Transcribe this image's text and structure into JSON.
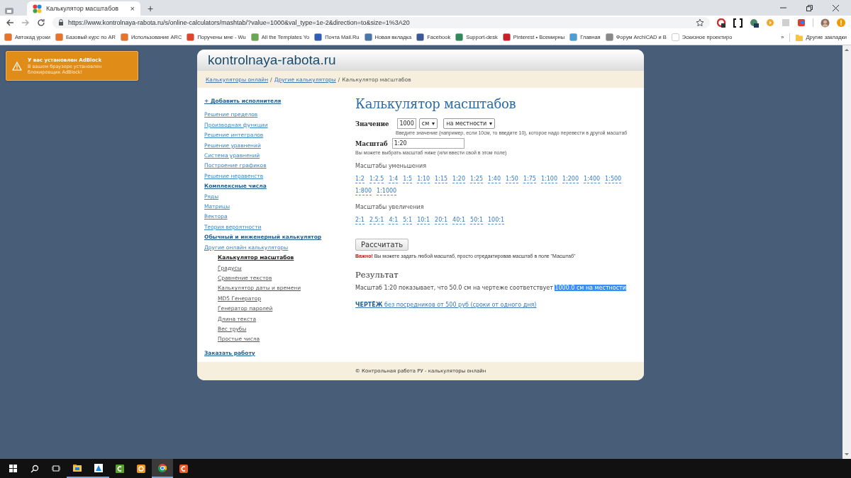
{
  "browser": {
    "tab": {
      "title": "Калькулятор масштабов",
      "close": "×"
    },
    "new_tab": "+",
    "url": "https://www.kontrolnaya-rabota.ru/s/online-calculators/mashtab/?value=1000&val_type=1e-2&direction=to&size=1%3A20",
    "bookmarks": [
      {
        "label": "Автокад уроки",
        "color": "#e8742a"
      },
      {
        "label": "Базовый курс по AR",
        "color": "#e8742a"
      },
      {
        "label": "Использование ARC",
        "color": "#e8742a"
      },
      {
        "label": "Поручены мне - Wu",
        "color": "#e0452c"
      },
      {
        "label": "All the Templates Yo",
        "color": "#6aa84f"
      },
      {
        "label": "Почта Mail.Ru",
        "color": "#2f5fb3"
      },
      {
        "label": "Новая вкладка",
        "color": "#4a76a8"
      },
      {
        "label": "Facebook",
        "color": "#3b5998"
      },
      {
        "label": "Support-desk",
        "color": "#2e8b57"
      },
      {
        "label": "Pinterest • Всемирны",
        "color": "#cb2027"
      },
      {
        "label": "Главная",
        "color": "#4a9fd8"
      },
      {
        "label": "Форум ArchiCAD и B",
        "color": "#888888"
      },
      {
        "label": "Эскизное проектиро",
        "color": "#ffffff"
      }
    ],
    "more": "»",
    "other_bookmarks": "Другие закладки"
  },
  "notice": {
    "title": "У вас установлен AdBlock",
    "text": "В вашем браузере установлен блокировщик AdBlock!"
  },
  "site": {
    "logo": "kontrolnaya-rabota.ru",
    "breadcrumbs": [
      {
        "label": "Калькуляторы онлайн",
        "kind": "link"
      },
      {
        "label": "Другие калькуляторы",
        "kind": "link"
      },
      {
        "label": "Калькулятор масштабов",
        "kind": "text"
      }
    ],
    "separator": "/",
    "sidebar": [
      {
        "label": "+ Добавить исполнителя",
        "kind": "section"
      },
      {
        "label": "Решение пределов",
        "kind": "link"
      },
      {
        "label": "Производная функции",
        "kind": "link"
      },
      {
        "label": "Решение интегралов",
        "kind": "link"
      },
      {
        "label": "Решение уравнений",
        "kind": "link"
      },
      {
        "label": "Система уравнений",
        "kind": "link"
      },
      {
        "label": "Построение графиков",
        "kind": "link"
      },
      {
        "label": "Решение неравенств",
        "kind": "link"
      },
      {
        "label": "Комплексные числа",
        "kind": "section"
      },
      {
        "label": "Ряды",
        "kind": "link"
      },
      {
        "label": "Матрицы",
        "kind": "link"
      },
      {
        "label": "Вектора",
        "kind": "link"
      },
      {
        "label": "Теория вероятности",
        "kind": "link"
      },
      {
        "label": "Обычный и инженерный калькулятор",
        "kind": "section"
      },
      {
        "label": "Другие онлайн калькуляторы",
        "kind": "link",
        "children": [
          {
            "label": "Калькулятор масштабов",
            "selected": true
          },
          {
            "label": "Градусы",
            "selected": false
          },
          {
            "label": "Сравнение текстов",
            "selected": false
          },
          {
            "label": "Калькулятор даты и времени",
            "selected": false
          },
          {
            "label": "MD5 Генератор",
            "selected": false
          },
          {
            "label": "Генератор паролей",
            "selected": false
          },
          {
            "label": "Длина текста",
            "selected": false
          },
          {
            "label": "Вес трубы",
            "selected": false
          },
          {
            "label": "Простые числа",
            "selected": false
          }
        ]
      },
      {
        "label": "Заказать работу",
        "kind": "section"
      }
    ],
    "calculator": {
      "title": "Калькулятор масштабов",
      "value_label": "Значение",
      "value": "1000",
      "unit": "см",
      "place": "на местности",
      "value_hint": "Введите значение (например, если 10см, то введите 10), которое надо перевести в другой масштаб",
      "scale_label": "Масштаб",
      "scale": "1:20",
      "scale_hint": "Вы можете выбрать масштаб ниже (или ввести свой в этом поле)",
      "reduce_title": "Масштабы уменьшения",
      "reduce": [
        "1:2",
        "1:2.5",
        "1:4",
        "1:5",
        "1:10",
        "1:15",
        "1:20",
        "1:25",
        "1:40",
        "1:50",
        "1:75",
        "1:100",
        "1:200",
        "1:400",
        "1:500",
        "1:800",
        "1:1000"
      ],
      "enlarge_title": "Масштабы увеличения",
      "enlarge": [
        "2:1",
        "2.5:1",
        "4:1",
        "5:1",
        "10:1",
        "20:1",
        "40:1",
        "50:1",
        "100:1"
      ],
      "button": "Рассчитать",
      "note": "**Важно!** Вы можете задать любой масштаб, просто отредактировав масштаб в поле \"Масштаб\"",
      "result_title": "Результат",
      "result_text": "Масштаб 1:20 показывает, что 50.0 см на чертеже соответствует",
      "result_selected": "1000.0 см на местности",
      "promo": "**ЧЕРТЁЖ** без посредников от 500 руб (сроки от одного дня)"
    },
    "footer": "© Контрольная работа РУ - калькуляторы онлайн"
  }
}
